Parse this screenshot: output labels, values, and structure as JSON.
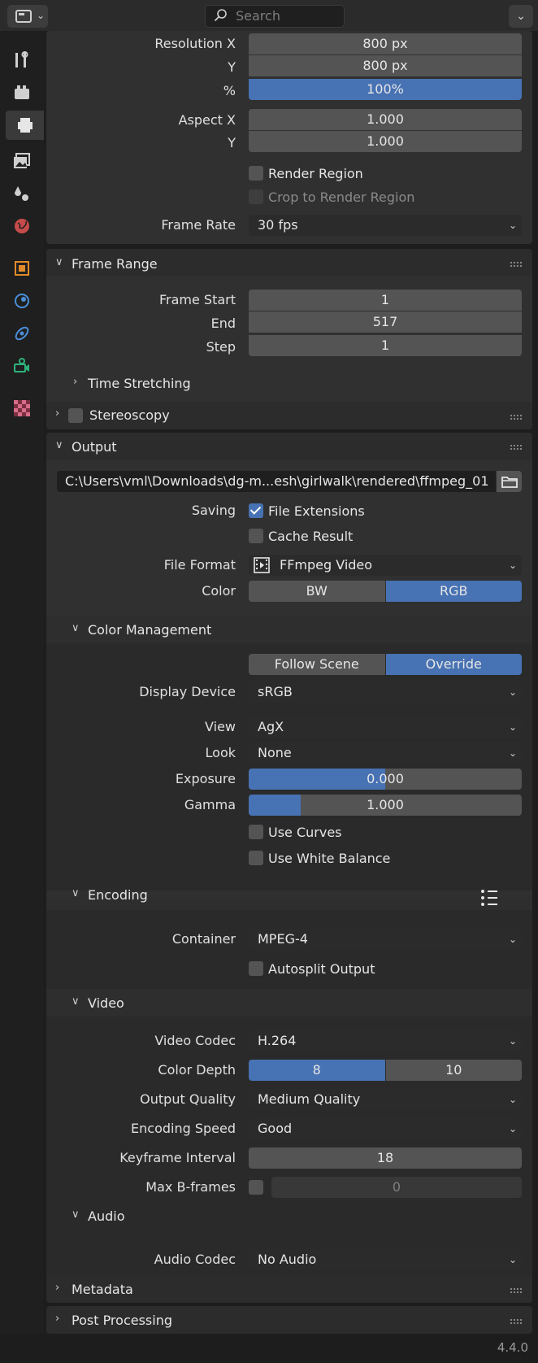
{
  "header": {
    "search_placeholder": "Search"
  },
  "format": {
    "resolution_x_label": "Resolution X",
    "resolution_x": "800 px",
    "resolution_y_label": "Y",
    "resolution_y": "800 px",
    "percent_label": "%",
    "percent": "100%",
    "aspect_x_label": "Aspect X",
    "aspect_x": "1.000",
    "aspect_y_label": "Y",
    "aspect_y": "1.000",
    "render_region": "Render Region",
    "crop_region": "Crop to Render Region",
    "frame_rate_label": "Frame Rate",
    "frame_rate": "30 fps"
  },
  "frame_range": {
    "title": "Frame Range",
    "start_label": "Frame Start",
    "start": "1",
    "end_label": "End",
    "end": "517",
    "step_label": "Step",
    "step": "1",
    "time_stretching": "Time Stretching"
  },
  "stereoscopy": {
    "title": "Stereoscopy"
  },
  "output": {
    "title": "Output",
    "path": "C:\\Users\\vml\\Downloads\\dg-m...esh\\girlwalk\\rendered\\ffmpeg_01",
    "saving_label": "Saving",
    "file_extensions": "File Extensions",
    "cache_result": "Cache Result",
    "file_format_label": "File Format",
    "file_format": "FFmpeg Video",
    "color_label": "Color",
    "color_bw": "BW",
    "color_rgb": "RGB"
  },
  "color_management": {
    "title": "Color Management",
    "follow_scene": "Follow Scene",
    "override": "Override",
    "display_device_label": "Display Device",
    "display_device": "sRGB",
    "view_label": "View",
    "view": "AgX",
    "look_label": "Look",
    "look": "None",
    "exposure_label": "Exposure",
    "exposure": "0.000",
    "exposure_fill_fraction": 0.5,
    "gamma_label": "Gamma",
    "gamma": "1.000",
    "gamma_fill_fraction": 0.19,
    "use_curves": "Use Curves",
    "use_white_balance": "Use White Balance"
  },
  "encoding": {
    "title": "Encoding",
    "container_label": "Container",
    "container": "MPEG-4",
    "autosplit": "Autosplit Output"
  },
  "video": {
    "title": "Video",
    "codec_label": "Video Codec",
    "codec": "H.264",
    "color_depth_label": "Color Depth",
    "depth_8": "8",
    "depth_10": "10",
    "quality_label": "Output Quality",
    "quality": "Medium Quality",
    "speed_label": "Encoding Speed",
    "speed": "Good",
    "keyframe_label": "Keyframe Interval",
    "keyframe": "18",
    "max_b_label": "Max B-frames",
    "max_b": "0"
  },
  "audio": {
    "title": "Audio",
    "codec_label": "Audio Codec",
    "codec": "No Audio"
  },
  "metadata": {
    "title": "Metadata"
  },
  "post_processing": {
    "title": "Post Processing"
  },
  "status": {
    "version": "4.4.0"
  },
  "accent_color": "#4772b3"
}
